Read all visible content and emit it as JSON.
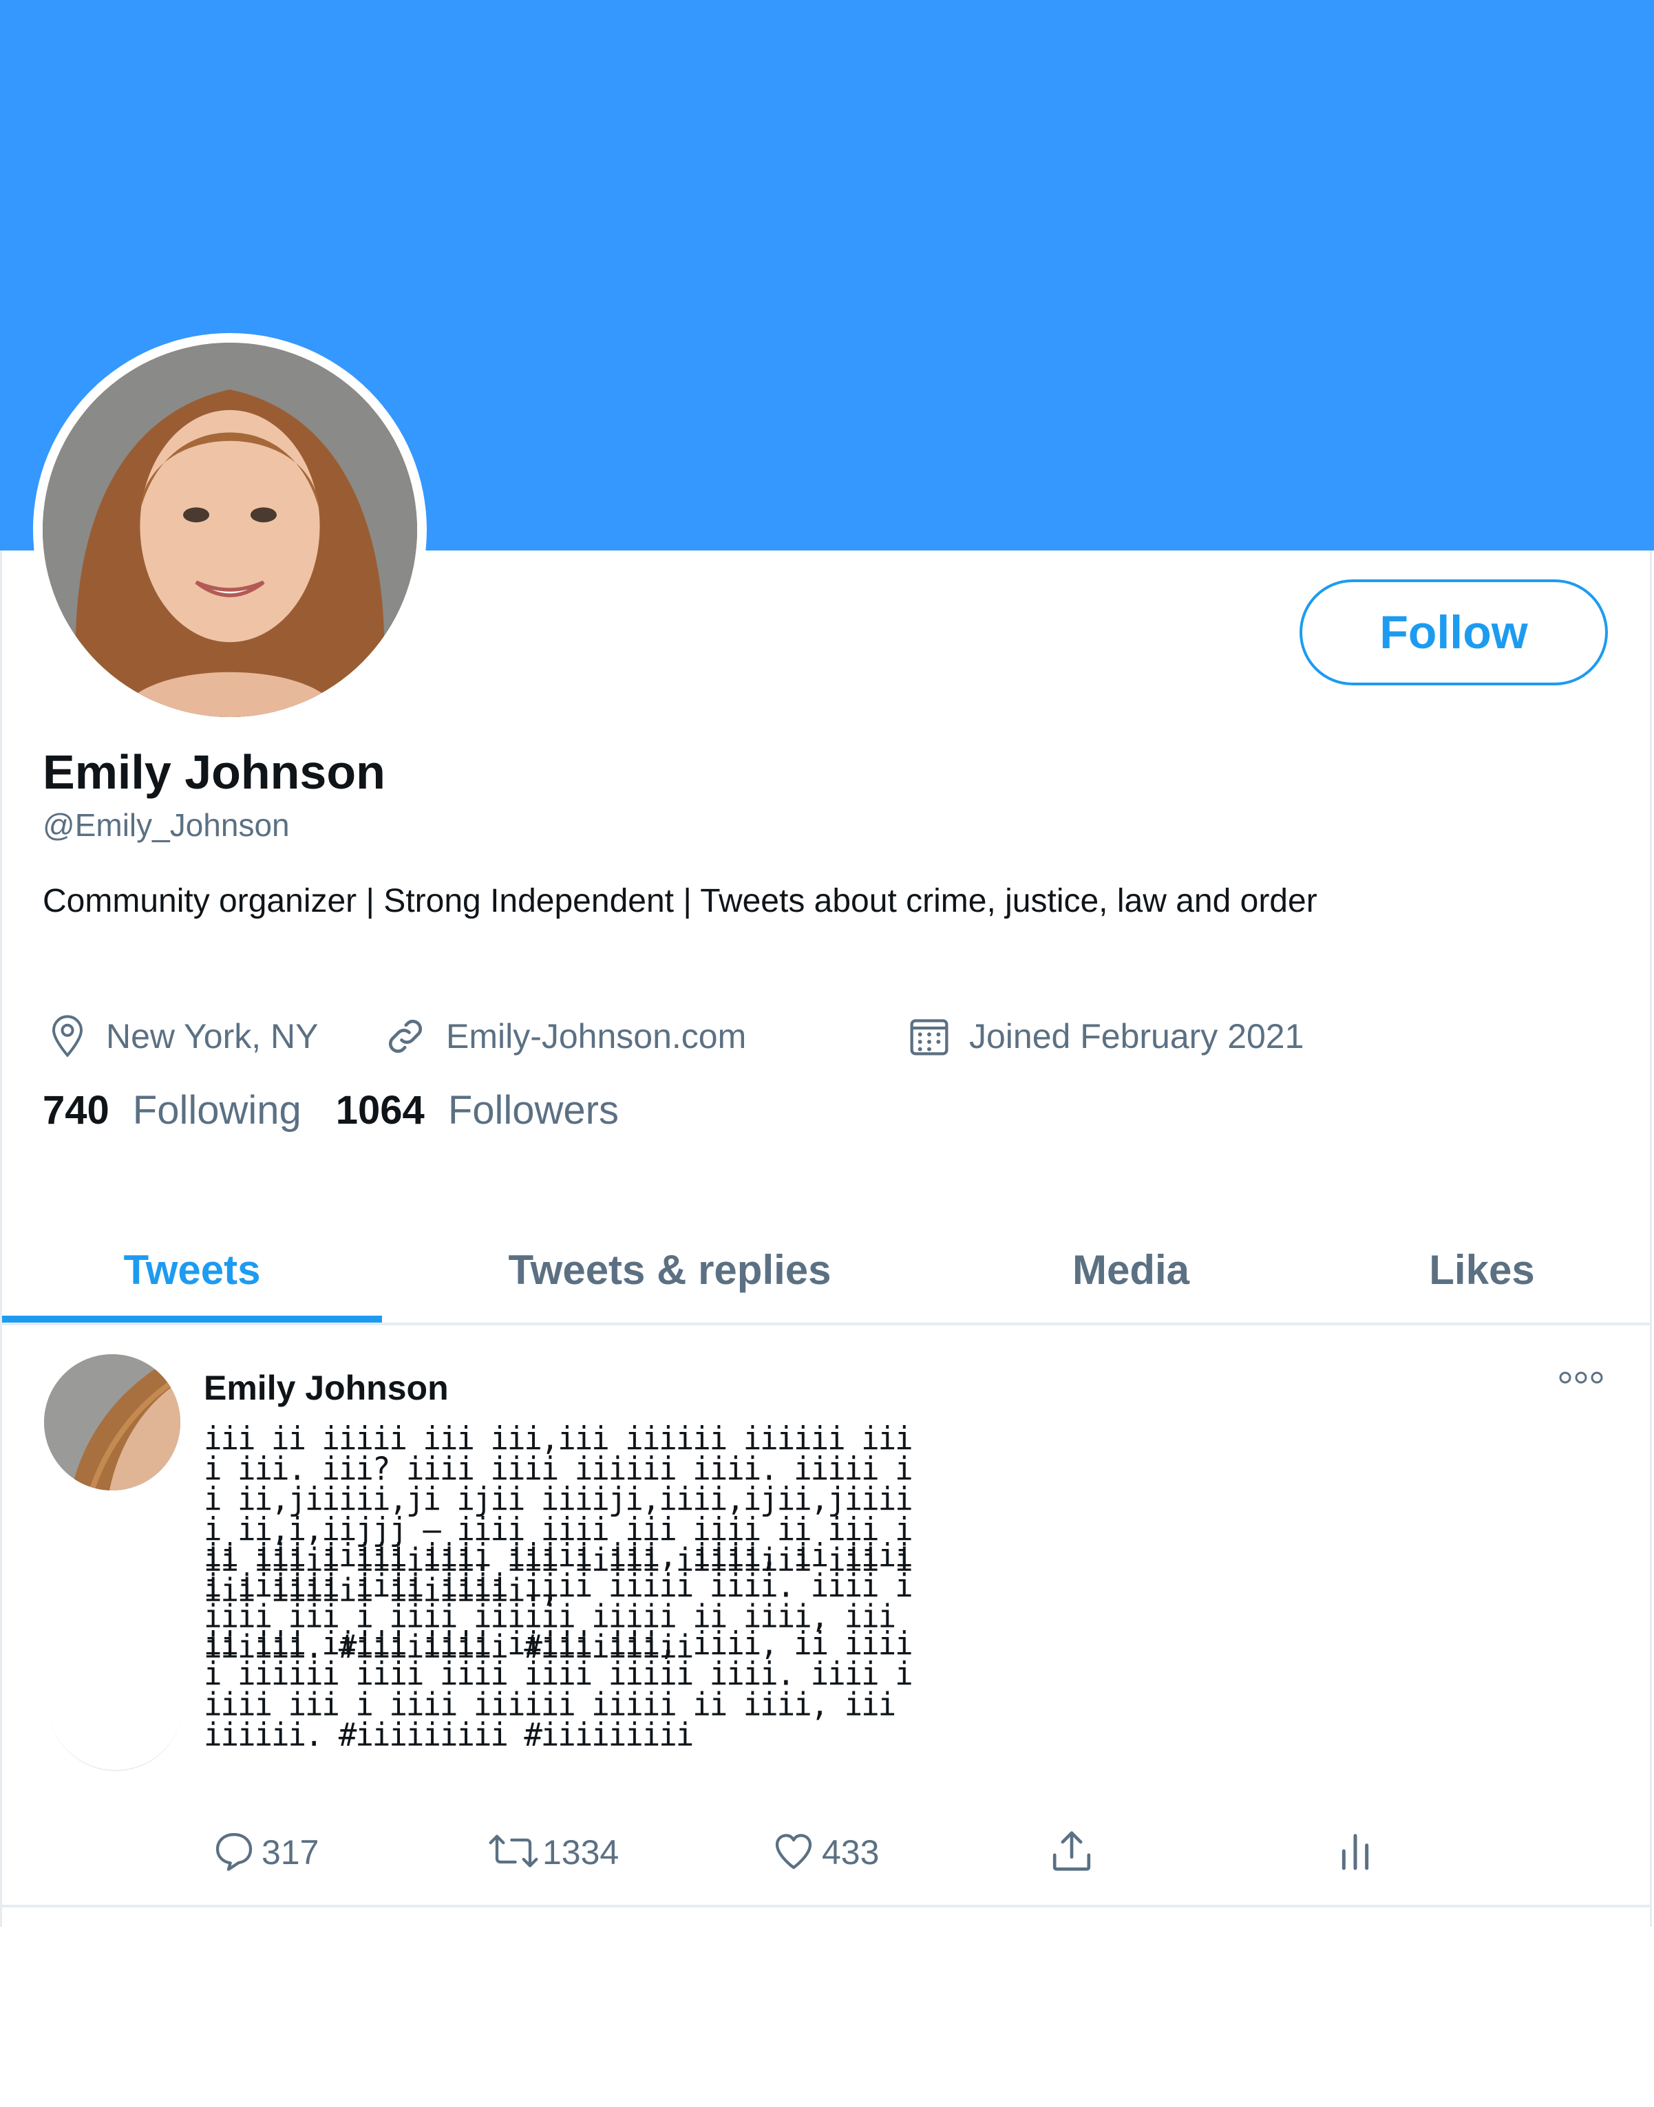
{
  "colors": {
    "banner": "#3498ff",
    "accent": "#1d9bf0",
    "text_primary": "#0f1419",
    "text_secondary": "#5b7083",
    "divider": "#e6ecf0"
  },
  "profile": {
    "follow_label": "Follow",
    "display_name": "Emily Johnson",
    "handle": "@Emily_Johnson",
    "bio": "Community organizer | Strong Independent | Tweets about crime, justice, law and order",
    "location": "New York, NY",
    "website": "Emily-Johnson.com",
    "joined": "Joined February 2021",
    "following_count": "740",
    "following_label": "Following",
    "followers_count": "1064",
    "followers_label": "Followers"
  },
  "tabs": [
    {
      "label": "Tweets",
      "active": true
    },
    {
      "label": "Tweets & replies",
      "active": false
    },
    {
      "label": "Media",
      "active": false
    },
    {
      "label": "Likes",
      "active": false
    }
  ],
  "tweet": {
    "author": "Emily Johnson",
    "paragraphs": [
      "iii ii iiiii iii iii,iii iiiiii iiiiii iiii iii. iii? iiii iiii iiiiii iiii. iiiii ii ii,jiiiii,ji ijii iiiiji,iiii,ijii,jiiiii ii,i,iijjj — iiii iiii iii iiii ii iii iii iiiii iiiiiii. iii iiiii iiiiiiii iii iiii iiiiii iiiiiiii.,",
      "ii iii iiiii iiii iiiii iii, iiii, ii iiiii iiiiii iiii iiii iiii iiiii iiii. iiii iiiii iii i iiii iiiiii iiiii ii iiii, iii iiiiii. #iiiiiiiii #iiiiiiiii",
      "ii iii iiiii iiii iiiii iii, iiii, ii iiiii iiiiii iiii iiii iiii iiiii iiii. iiii iiiii iii i iiii iiiiii iiiii ii iiii, iii iiiiii. #iiiiiiiii #iiiiiiiii"
    ],
    "reply_count": "317",
    "retweet_count": "1334",
    "like_count": "433"
  },
  "icons": {
    "location": "map-pin-icon",
    "website": "link-icon",
    "joined": "calendar-icon",
    "reply": "comment-icon",
    "retweet": "retweet-icon",
    "like": "heart-icon",
    "share": "share-icon",
    "analytics": "analytics-icon",
    "more": "more-icon"
  }
}
